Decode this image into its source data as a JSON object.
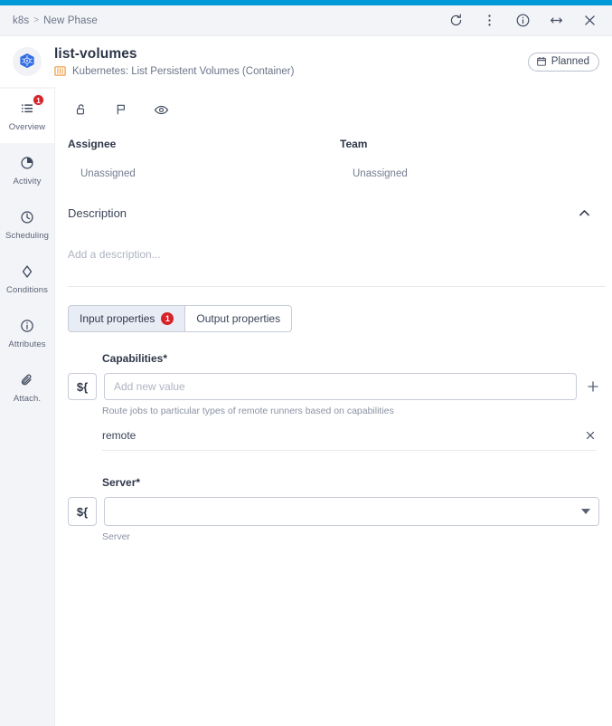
{
  "window": {
    "breadcrumb_root": "k8s",
    "breadcrumb_sep": ">",
    "breadcrumb_current": "New Phase",
    "icons": [
      "refresh-icon",
      "more-vertical-icon",
      "info-icon",
      "resize-horizontal-icon",
      "close-icon"
    ]
  },
  "header": {
    "avatar_icon": "kubernetes-logo",
    "title": "list-volumes",
    "subtitle_icon": "container-icon",
    "subtitle": "Kubernetes: List Persistent Volumes (Container)",
    "status_badge": {
      "label": "Planned",
      "icon": "calendar-icon"
    }
  },
  "sidebar": {
    "items": [
      {
        "label": "Overview",
        "icon": "list-icon",
        "badge": "1",
        "active": true
      },
      {
        "label": "Activity",
        "icon": "pie-chart-icon",
        "badge": "",
        "active": false
      },
      {
        "label": "Scheduling",
        "icon": "clock-icon",
        "badge": "",
        "active": false
      },
      {
        "label": "Conditions",
        "icon": "diamond-icon",
        "badge": "",
        "active": false
      },
      {
        "label": "Attributes",
        "icon": "info-icon",
        "badge": "",
        "active": false
      },
      {
        "label": "Attach.",
        "icon": "paperclip-icon",
        "badge": "",
        "active": false
      }
    ]
  },
  "toolbar": {
    "lock_icon": "unlock-icon",
    "flag_icon": "flag-icon",
    "eye_icon": "eye-icon"
  },
  "meta": {
    "assignee_label": "Assignee",
    "assignee_value": "Unassigned",
    "team_label": "Team",
    "team_value": "Unassigned"
  },
  "description": {
    "title": "Description",
    "collapse_icon": "chevron-up-icon",
    "placeholder": "Add a description..."
  },
  "tabs": [
    {
      "label": "Input properties",
      "badge": "1",
      "active": true
    },
    {
      "label": "Output properties",
      "badge": "",
      "active": false
    }
  ],
  "form": {
    "capabilities": {
      "label": "Capabilities",
      "required_marker": "*",
      "expr_button": "${",
      "input_value": "",
      "placeholder": "Add new value",
      "add_icon": "plus-icon",
      "help": "Route jobs to particular types of remote runners based on capabilities",
      "values": [
        {
          "text": "remote",
          "remove_icon": "close-icon"
        }
      ]
    },
    "server": {
      "label": "Server",
      "required_marker": "*",
      "expr_button": "${",
      "selected": "",
      "caret_icon": "chevron-down-icon",
      "help": "Server"
    }
  },
  "colors": {
    "accent": "#0099d8",
    "badge_red": "#d8232a",
    "kube_blue": "#326ce5",
    "container_orange": "#f0a04b",
    "sidebar_bg": "#f3f4f7"
  }
}
